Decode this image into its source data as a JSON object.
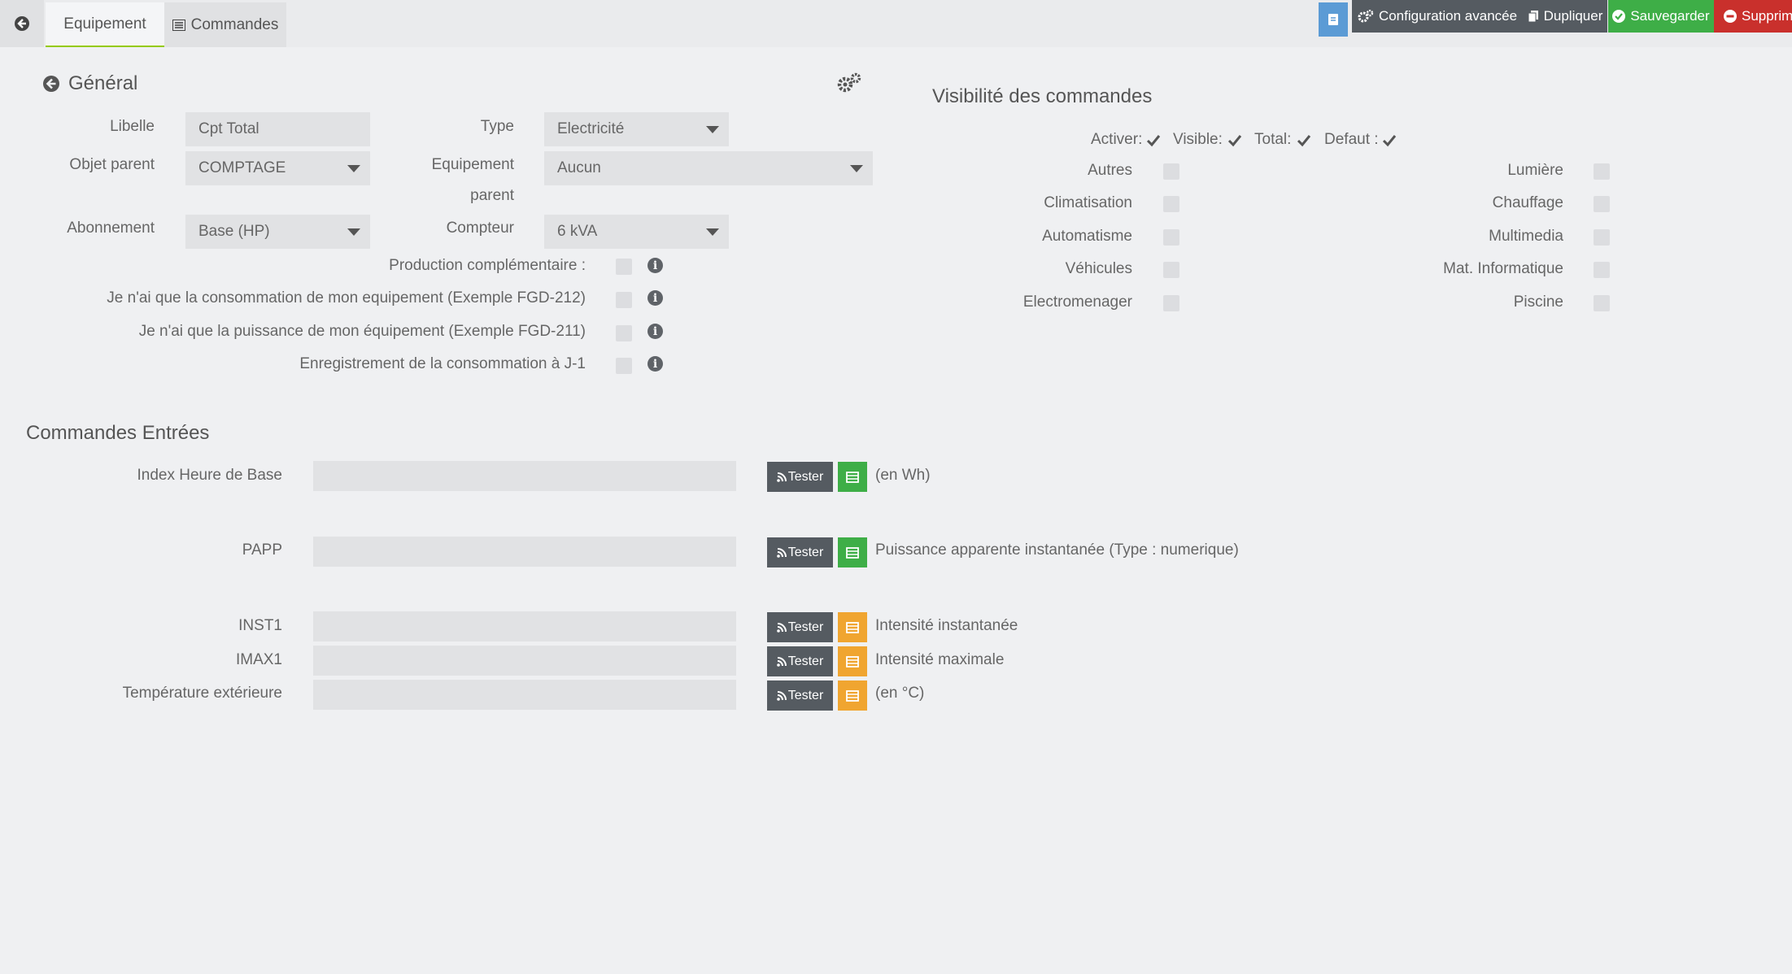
{
  "tabs": {
    "equipement": "Equipement",
    "commandes": "Commandes"
  },
  "toolbar": {
    "config": "Configuration avancée",
    "dupliquer": "Dupliquer",
    "sauvegarder": "Sauvegarder",
    "supprimer": "Supprime"
  },
  "general": {
    "title": "Général",
    "libelle_label": "Libelle",
    "libelle_value": "Cpt Total",
    "objet_parent_label": "Objet parent",
    "objet_parent_value": "COMPTAGE",
    "abonnement_label": "Abonnement",
    "abonnement_value": "Base (HP)",
    "type_label": "Type",
    "type_value": "Electricité",
    "equip_parent_label_1": "Equipement",
    "equip_parent_label_2": "parent",
    "equip_parent_value": "Aucun",
    "compteur_label": "Compteur",
    "compteur_value": "6 kVA",
    "options": [
      "Production complémentaire :",
      "Je n'ai que la consommation de mon equipement (Exemple FGD-212)",
      "Je n'ai que la puissance de mon équipement (Exemple FGD-211)",
      "Enregistrement de la consommation à J-1"
    ]
  },
  "visibilite": {
    "title": "Visibilité des commandes",
    "activer": "Activer:",
    "visible": "Visible:",
    "total": "Total:",
    "defaut": "Defaut :",
    "left": [
      "Autres",
      "Climatisation",
      "Automatisme",
      "Véhicules",
      "Electromenager"
    ],
    "right": [
      "Lumière",
      "Chauffage",
      "Multimedia",
      "Mat. Informatique",
      "Piscine"
    ]
  },
  "commandes": {
    "title": "Commandes Entrées",
    "tester_label": "Tester",
    "rows": [
      {
        "label": "Index Heure de Base",
        "desc": "(en Wh)",
        "histo_color": "green"
      },
      {
        "label": "PAPP",
        "desc": "Puissance apparente instantanée (Type : numerique)",
        "histo_color": "green"
      },
      {
        "label": "INST1",
        "desc": "Intensité instantanée",
        "histo_color": "orange"
      },
      {
        "label": "IMAX1",
        "desc": "Intensité maximale",
        "histo_color": "orange"
      },
      {
        "label": "Température extérieure",
        "desc": "(en °C)",
        "histo_color": "orange"
      }
    ]
  },
  "colors": {
    "accent_green": "#3eae47",
    "danger": "#c9302c",
    "info_blue": "#5b9bd5",
    "orange": "#f0a530"
  }
}
